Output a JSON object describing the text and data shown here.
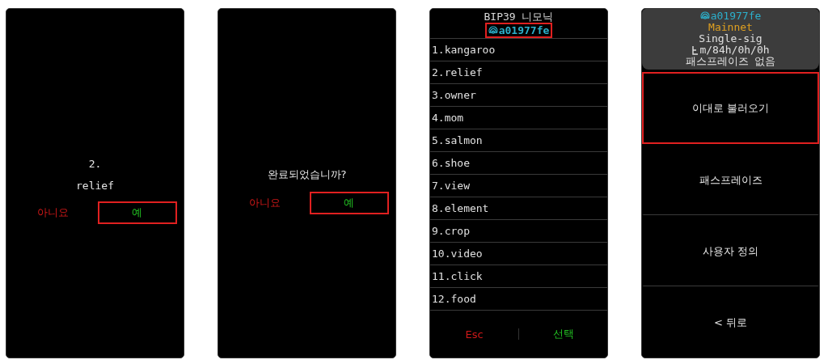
{
  "screens": [
    {
      "kind": "confirm",
      "mono": true,
      "lines": [
        "2.",
        "relief"
      ],
      "buttons": [
        {
          "label": "아니요",
          "kind": "cancel",
          "selected": false
        },
        {
          "label": "예",
          "kind": "ok",
          "selected": true
        }
      ]
    },
    {
      "kind": "confirm",
      "mono": false,
      "lines": [
        "완료되었습니까?"
      ],
      "buttons": [
        {
          "label": "아니요",
          "kind": "cancel",
          "selected": false
        },
        {
          "label": "예",
          "kind": "ok",
          "selected": true
        }
      ]
    },
    {
      "kind": "list",
      "title": "BIP39 니모닉",
      "fingerprint": "a01977fe",
      "fingerprint_selected": true,
      "items": [
        "1.kangaroo",
        "2.relief",
        "3.owner",
        "4.mom",
        "5.salmon",
        "6.shoe",
        "7.view",
        "8.element",
        "9.crop",
        "10.video",
        "11.click",
        "12.food"
      ],
      "buttons": [
        {
          "label": "Esc",
          "kind": "cancel"
        },
        {
          "label": "선택",
          "kind": "ok"
        }
      ]
    },
    {
      "kind": "menu",
      "header": {
        "fingerprint": "a01977fe",
        "network": "Mainnet",
        "policy": "Single-sig",
        "path": "m/84h/0h/0h",
        "passphrase": "패스프레이즈 없음"
      },
      "items": [
        {
          "label": "이대로 불러오기",
          "selected": true
        },
        {
          "label": "패스프레이즈",
          "selected": false
        },
        {
          "label": "사용자 정의",
          "selected": false
        },
        {
          "label": "< 뒤로",
          "selected": false
        }
      ]
    }
  ]
}
